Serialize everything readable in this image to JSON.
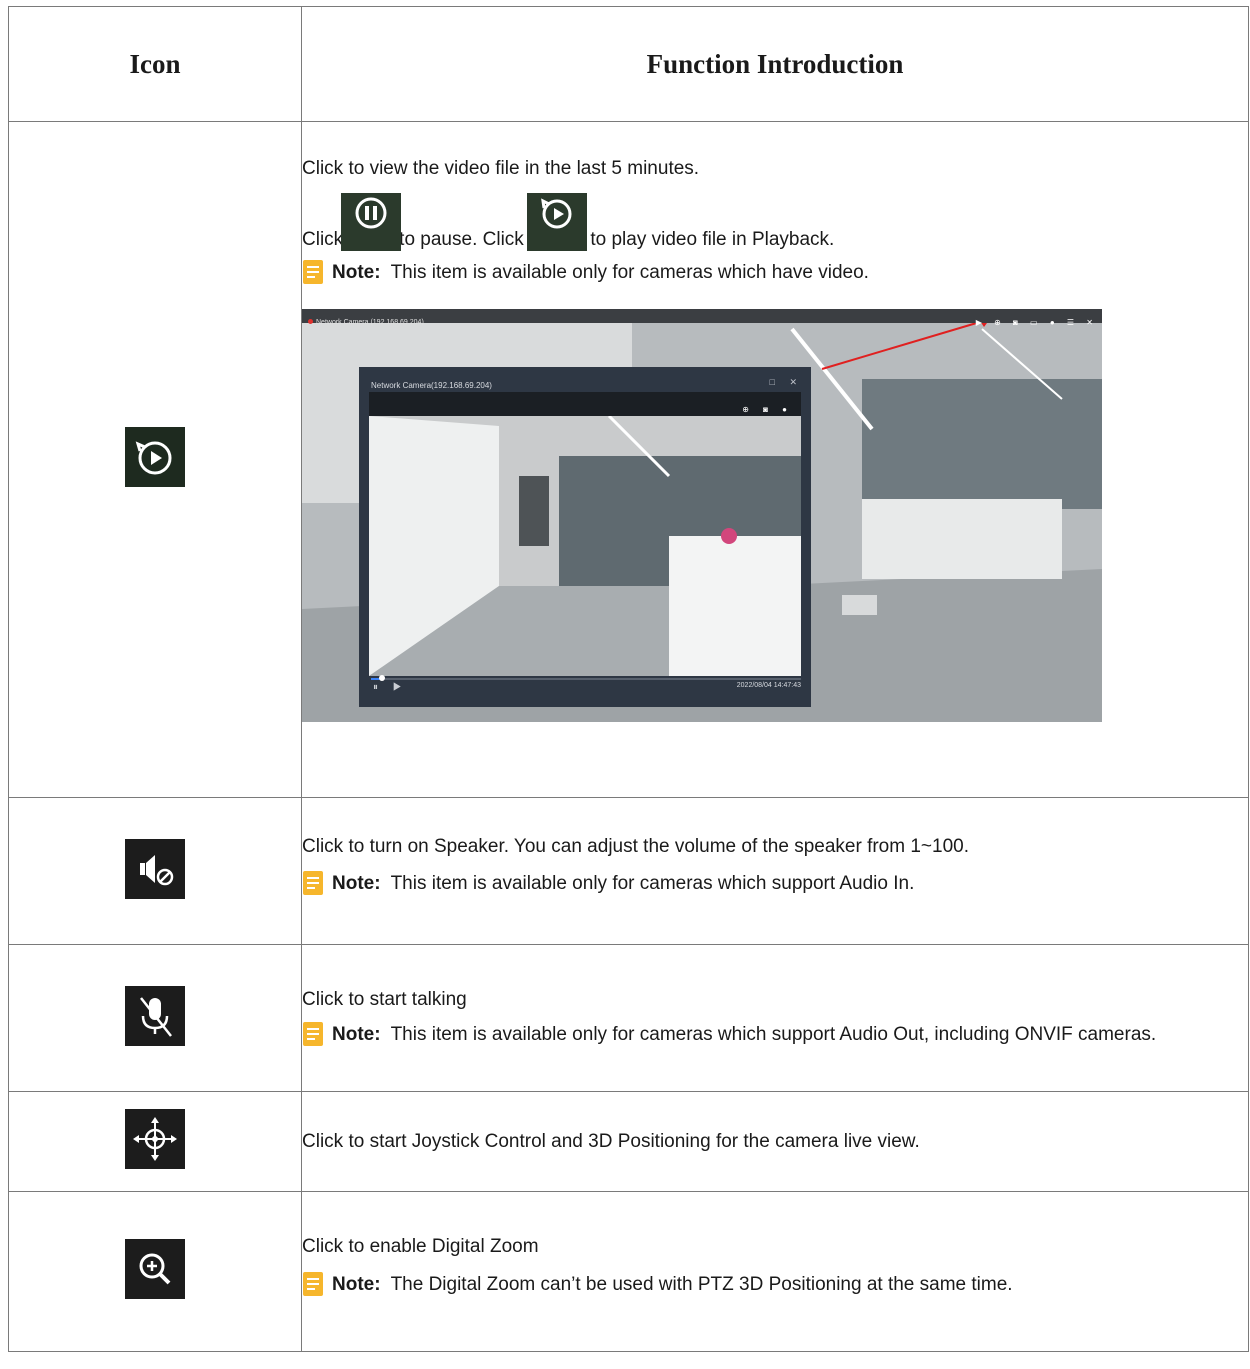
{
  "header": {
    "icon_col": "Icon",
    "function_col": "Function Introduction"
  },
  "rows": [
    {
      "icon": "playback-icon",
      "line1": "Click to view the video file in the last 5 minutes.",
      "line2_a": "Click",
      "line2_b": "to pause. Click",
      "line2_c": "to play video file in Playback.",
      "inline_icon_1": "pause-icon",
      "inline_icon_2": "playback-icon",
      "note_label": "Note:",
      "note_text": "This item is available only for cameras which have video.",
      "screenshot": {
        "window_title": "Network Camera (192.168.69.204)",
        "popup_title": "Network Camera(192.168.69.204)",
        "timestamp": "2022/08/04 14:47:43",
        "progress": 0.02
      }
    },
    {
      "icon": "speaker-off-icon",
      "line1": "Click to turn on Speaker. You can adjust the volume of the speaker from 1~100.",
      "note_label": "Note:",
      "note_text": "This item is available only for cameras which support Audio In."
    },
    {
      "icon": "microphone-off-icon",
      "line1": "Click to start talking",
      "note_label": "Note:",
      "note_text": "This item is available only for cameras which support Audio Out, including ONVIF cameras."
    },
    {
      "icon": "joystick-icon",
      "line1": "Click to start Joystick Control and 3D Positioning for the camera live view."
    },
    {
      "icon": "zoom-in-icon",
      "line1": "Click to enable Digital Zoom",
      "note_label": "Note:",
      "note_text": "The Digital Zoom can’t be used with PTZ 3D Positioning at the same time."
    }
  ],
  "colors": {
    "note_icon": "#f6b62c",
    "border": "#7a7a7a",
    "arrow": "#e02020"
  }
}
